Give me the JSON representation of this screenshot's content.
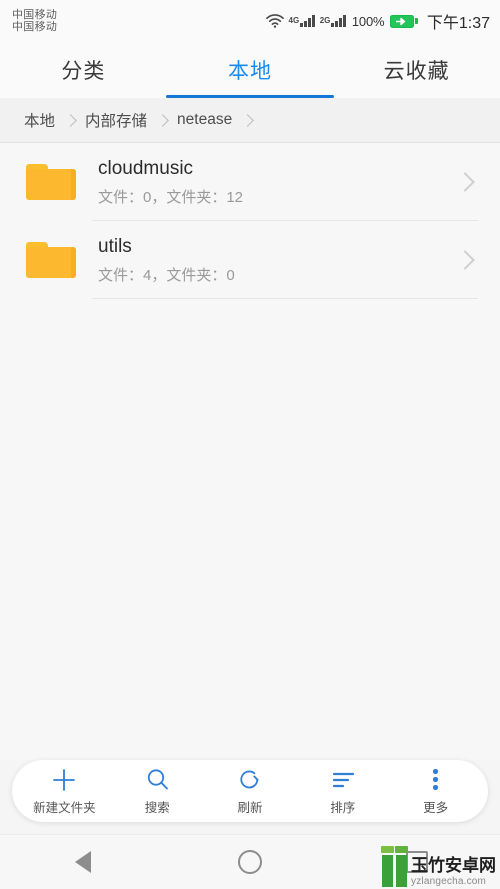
{
  "status_bar": {
    "carrier_lines": [
      "中国移动",
      "中国移动"
    ],
    "wifi_icon": "wifi-icon",
    "signal_1_label": "4G",
    "signal_2_label": "2G",
    "battery_percent": "100%",
    "battery_icon": "battery-charging-icon",
    "battery_color": "#23c45a",
    "time": "下午1:37"
  },
  "tabs": {
    "items": [
      {
        "label": "分类",
        "active": false
      },
      {
        "label": "本地",
        "active": true
      },
      {
        "label": "云收藏",
        "active": false
      }
    ],
    "active_color": "#1a8cf0",
    "indicator_color": "#1477d6"
  },
  "breadcrumb": {
    "items": [
      "本地",
      "内部存储",
      "netease"
    ],
    "separator_icon": "chevron-right-icon"
  },
  "file_list": {
    "rows": [
      {
        "name": "cloudmusic",
        "detail": "文件：0，文件夹：12",
        "icon": "folder-icon",
        "chevron": "chevron-right-icon"
      },
      {
        "name": "utils",
        "detail": "文件：4，文件夹：0",
        "icon": "folder-icon",
        "chevron": "chevron-right-icon"
      }
    ],
    "folder_color": "#fcb82e"
  },
  "toolbar": {
    "accent_color": "#2f7ed8",
    "items": [
      {
        "label": "新建文件夹",
        "icon": "plus-icon"
      },
      {
        "label": "搜索",
        "icon": "search-icon"
      },
      {
        "label": "刷新",
        "icon": "refresh-icon"
      },
      {
        "label": "排序",
        "icon": "sort-icon"
      },
      {
        "label": "更多",
        "icon": "more-vertical-icon"
      }
    ]
  },
  "nav_bar": {
    "back_icon": "back-triangle-icon",
    "home_icon": "home-circle-icon",
    "recents_icon": "recents-square-icon"
  },
  "watermark": {
    "title": "玉竹安卓网",
    "url": "yzlangecha.com",
    "logo_color": "#3aa03a"
  }
}
